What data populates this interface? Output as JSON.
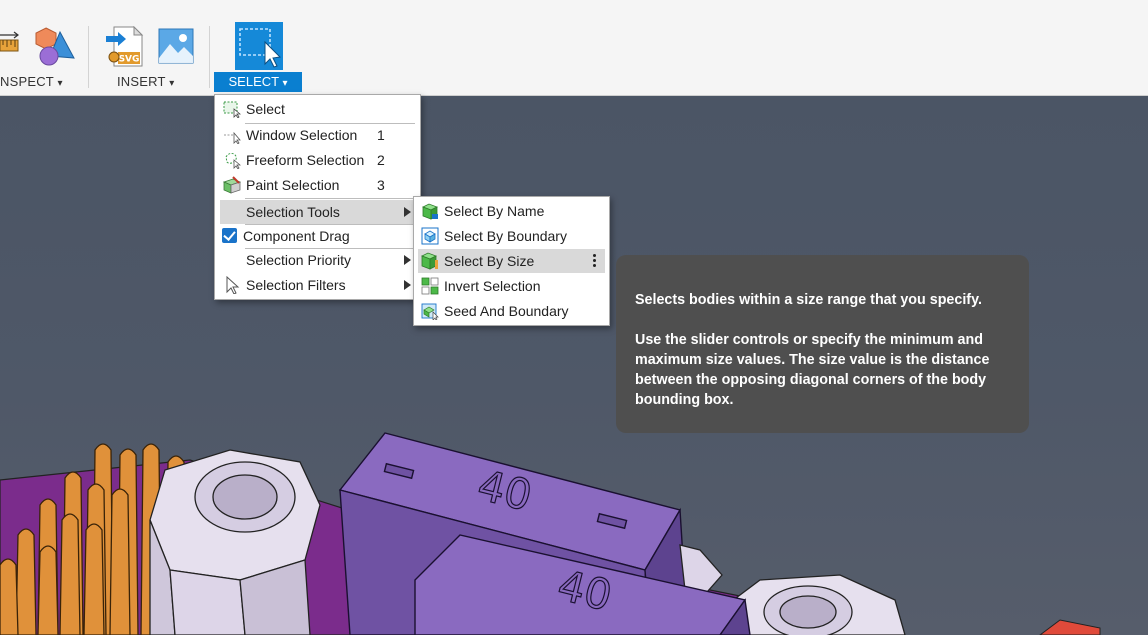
{
  "toolbar": {
    "inspect_label": "NSPECT",
    "insert_label": "INSERT",
    "select_label": "SELECT",
    "caret": "▾",
    "svg_badge": "SVG"
  },
  "select_menu": {
    "items": [
      {
        "label": "Select",
        "key": "",
        "icon": "select-icon"
      },
      {
        "label": "Window Selection",
        "key": "1",
        "icon": "window-selection-icon"
      },
      {
        "label": "Freeform Selection",
        "key": "2",
        "icon": "freeform-selection-icon"
      },
      {
        "label": "Paint Selection",
        "key": "3",
        "icon": "paint-selection-icon"
      },
      {
        "label": "Selection Tools",
        "key": "",
        "icon": ""
      },
      {
        "label": "Component Drag",
        "key": "",
        "icon": "checkbox-checked-icon"
      },
      {
        "label": "Selection Priority",
        "key": "",
        "icon": ""
      },
      {
        "label": "Selection Filters",
        "key": "",
        "icon": "cursor-arrow-icon"
      }
    ]
  },
  "tools_menu": {
    "items": [
      {
        "label": "Select By Name",
        "icon": "select-by-name-icon"
      },
      {
        "label": "Select By Boundary",
        "icon": "select-by-boundary-icon"
      },
      {
        "label": "Select By Size",
        "icon": "select-by-size-icon"
      },
      {
        "label": "Invert Selection",
        "icon": "invert-selection-icon"
      },
      {
        "label": "Seed And Boundary",
        "icon": "seed-and-boundary-icon"
      }
    ]
  },
  "tooltip": {
    "line1": "Selects bodies within a size range that you specify.",
    "line2": "Use the slider controls or specify the minimum and maximum size values. The size value is the distance between the opposing diagonal corners of the body bounding box."
  },
  "viewport": {
    "part_label_1": "40",
    "part_label_2": "40"
  },
  "colors": {
    "accent": "#0a7fd0",
    "menu_highlight": "#d9d9d9",
    "tooltip_bg": "#4f4f4f",
    "viewport_bg": "#4b5565",
    "part_purple": "#7a5ab0",
    "heatsink_orange": "#e0913a"
  }
}
